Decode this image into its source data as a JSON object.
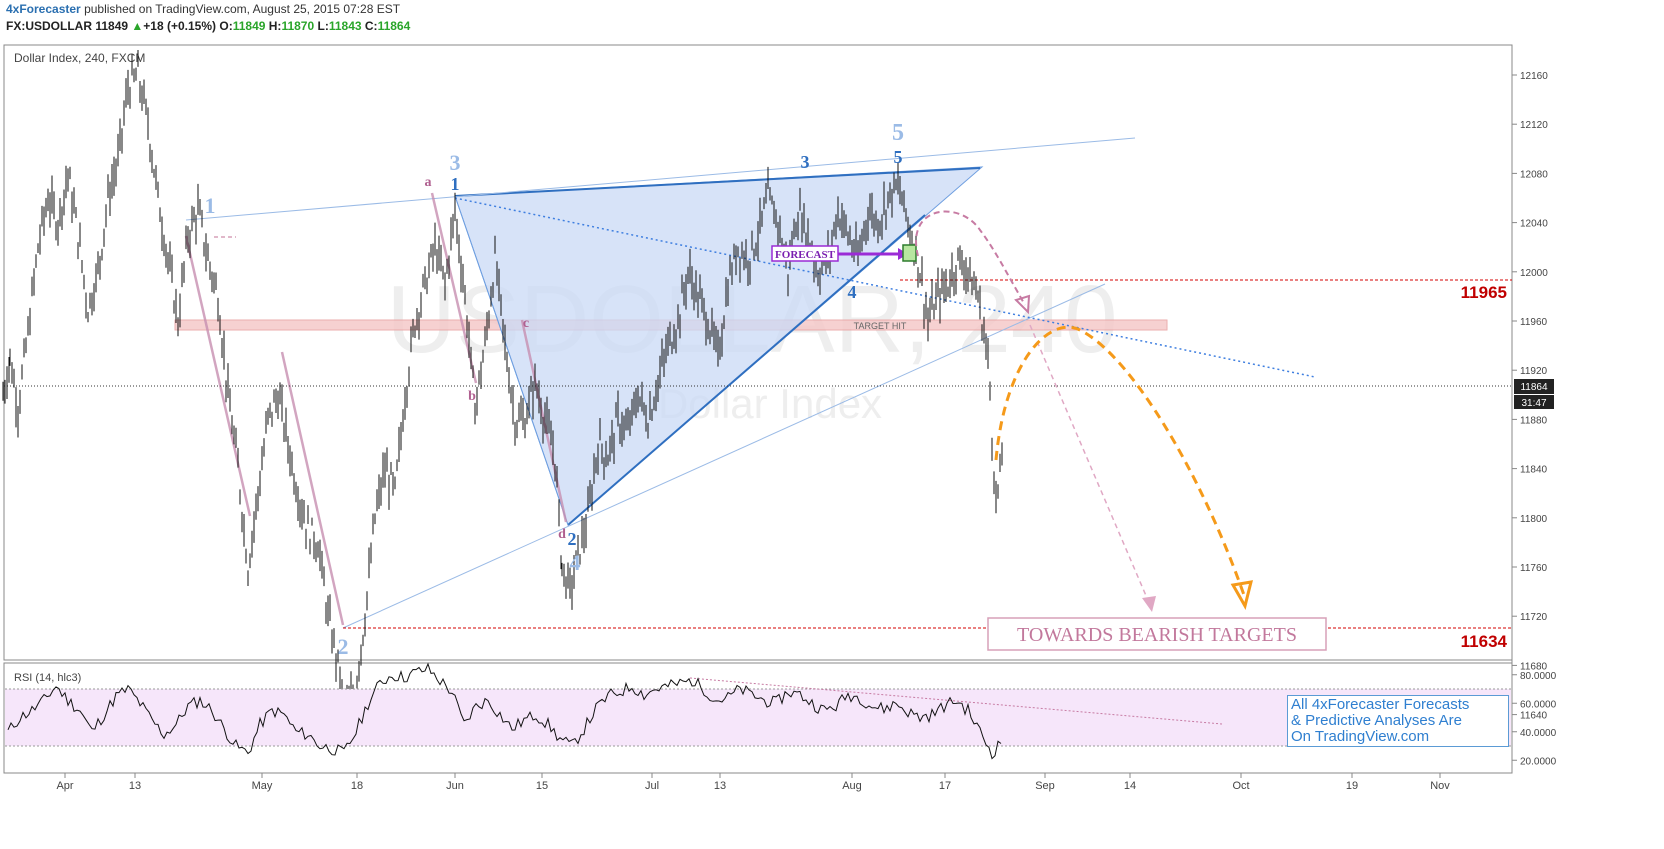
{
  "header": {
    "publisher": "4xForecaster",
    "published_text": "published on TradingView.com, August 25, 2015 07:28 EST",
    "symbol": "FX:USDOLLAR",
    "last": "11849",
    "change": "+18 (+0.15%)",
    "open_label": "O:",
    "open": "11849",
    "high_label": "H:",
    "high": "11870",
    "low_label": "L:",
    "low": "11843",
    "close_label": "C:",
    "close": "11864"
  },
  "chart_title": "Dollar Index, 240, FXCM",
  "watermark": {
    "line1": "USDOLLAR, 240",
    "line2": "Dollar Index"
  },
  "rsi_label": "RSI (14, hlc3)",
  "info_box": [
    "All 4xForecaster Forecasts",
    "& Predictive Analyses Are",
    "On TradingView.com"
  ],
  "annotations": {
    "forecast": "FORECAST",
    "target_hit": "TARGET HIT",
    "towards": "TOWARDS BEARISH TARGETS",
    "level_high": "11965",
    "level_low": "11634",
    "current_price": "11864",
    "countdown": "31:47"
  },
  "colors": {
    "accent": "#2a6fb0",
    "wave_light": "#9bbbe6",
    "wave_dark": "#2f6fc0",
    "abcd": "#c0759d",
    "level": "#d40000",
    "forecast_purple": "#9b2bd6",
    "orange": "#f59a1a",
    "triangle_fill": "#c9daf5",
    "rsi_band": "#f6e6fa"
  },
  "chart_data": {
    "type": "line",
    "x_ticks": [
      "Apr",
      "13",
      "May",
      "18",
      "Jun",
      "15",
      "Jul",
      "13",
      "Aug",
      "17",
      "Sep",
      "14",
      "Oct",
      "19",
      "Nov"
    ],
    "price_axis": [
      12160,
      12120,
      12080,
      12040,
      12000,
      11960,
      11920,
      11880,
      11840,
      11800,
      11760,
      11720,
      11680,
      11640
    ],
    "price_ylim": [
      11610,
      12195
    ],
    "rsi_axis": [
      80,
      60,
      40,
      20
    ],
    "rsi_band": [
      30,
      70
    ],
    "price_path": [
      [
        3,
        11900
      ],
      [
        10,
        11930
      ],
      [
        18,
        11890
      ],
      [
        28,
        11950
      ],
      [
        38,
        12020
      ],
      [
        48,
        12060
      ],
      [
        58,
        12040
      ],
      [
        68,
        12080
      ],
      [
        78,
        12030
      ],
      [
        88,
        11970
      ],
      [
        98,
        12000
      ],
      [
        108,
        12060
      ],
      [
        118,
        12090
      ],
      [
        128,
        12150
      ],
      [
        138,
        12160
      ],
      [
        148,
        12120
      ],
      [
        158,
        12060
      ],
      [
        168,
        12010
      ],
      [
        178,
        11960
      ],
      [
        188,
        12030
      ],
      [
        198,
        12050
      ],
      [
        208,
        12010
      ],
      [
        218,
        11980
      ],
      [
        228,
        11900
      ],
      [
        238,
        11840
      ],
      [
        248,
        11760
      ],
      [
        258,
        11820
      ],
      [
        268,
        11880
      ],
      [
        278,
        11900
      ],
      [
        288,
        11860
      ],
      [
        298,
        11820
      ],
      [
        308,
        11790
      ],
      [
        318,
        11780
      ],
      [
        328,
        11720
      ],
      [
        338,
        11680
      ],
      [
        345,
        11640
      ],
      [
        355,
        11660
      ],
      [
        365,
        11720
      ],
      [
        375,
        11800
      ],
      [
        385,
        11840
      ],
      [
        395,
        11820
      ],
      [
        405,
        11900
      ],
      [
        415,
        11960
      ],
      [
        425,
        11990
      ],
      [
        435,
        12020
      ],
      [
        445,
        11990
      ],
      [
        455,
        12050
      ],
      [
        465,
        11980
      ],
      [
        475,
        11890
      ],
      [
        485,
        11940
      ],
      [
        495,
        12010
      ],
      [
        505,
        11940
      ],
      [
        515,
        11880
      ],
      [
        525,
        11880
      ],
      [
        535,
        11910
      ],
      [
        545,
        11880
      ],
      [
        555,
        11850
      ],
      [
        562,
        11760
      ],
      [
        570,
        11740
      ],
      [
        578,
        11770
      ],
      [
        588,
        11800
      ],
      [
        598,
        11860
      ],
      [
        608,
        11850
      ],
      [
        618,
        11880
      ],
      [
        628,
        11870
      ],
      [
        638,
        11900
      ],
      [
        648,
        11880
      ],
      [
        658,
        11910
      ],
      [
        668,
        11940
      ],
      [
        678,
        11960
      ],
      [
        688,
        12000
      ],
      [
        698,
        11980
      ],
      [
        708,
        11960
      ],
      [
        718,
        11930
      ],
      [
        728,
        11990
      ],
      [
        738,
        12020
      ],
      [
        748,
        12010
      ],
      [
        758,
        12030
      ],
      [
        768,
        12060
      ],
      [
        778,
        12040
      ],
      [
        788,
        12000
      ],
      [
        798,
        12050
      ],
      [
        808,
        12030
      ],
      [
        818,
        12000
      ],
      [
        828,
        12010
      ],
      [
        838,
        12050
      ],
      [
        848,
        12030
      ],
      [
        858,
        12010
      ],
      [
        868,
        12050
      ],
      [
        878,
        12040
      ],
      [
        888,
        12060
      ],
      [
        898,
        12070
      ],
      [
        908,
        12040
      ],
      [
        918,
        12010
      ],
      [
        928,
        11960
      ],
      [
        938,
        11980
      ],
      [
        948,
        11990
      ],
      [
        958,
        12010
      ],
      [
        968,
        12000
      ],
      [
        978,
        11980
      ],
      [
        988,
        11930
      ],
      [
        996,
        11810
      ],
      [
        1004,
        11860
      ]
    ],
    "rsi_path": [
      [
        8,
        40
      ],
      [
        20,
        50
      ],
      [
        32,
        55
      ],
      [
        44,
        62
      ],
      [
        56,
        72
      ],
      [
        68,
        62
      ],
      [
        80,
        55
      ],
      [
        92,
        40
      ],
      [
        104,
        52
      ],
      [
        116,
        65
      ],
      [
        128,
        70
      ],
      [
        140,
        60
      ],
      [
        152,
        48
      ],
      [
        164,
        38
      ],
      [
        176,
        45
      ],
      [
        188,
        58
      ],
      [
        200,
        62
      ],
      [
        212,
        55
      ],
      [
        224,
        42
      ],
      [
        236,
        30
      ],
      [
        248,
        25
      ],
      [
        260,
        45
      ],
      [
        272,
        55
      ],
      [
        284,
        52
      ],
      [
        296,
        40
      ],
      [
        308,
        38
      ],
      [
        320,
        30
      ],
      [
        332,
        28
      ],
      [
        344,
        25
      ],
      [
        356,
        40
      ],
      [
        368,
        60
      ],
      [
        380,
        74
      ],
      [
        392,
        80
      ],
      [
        404,
        78
      ],
      [
        416,
        82
      ],
      [
        428,
        84
      ],
      [
        440,
        76
      ],
      [
        452,
        68
      ],
      [
        464,
        45
      ],
      [
        476,
        58
      ],
      [
        488,
        62
      ],
      [
        500,
        52
      ],
      [
        512,
        42
      ],
      [
        524,
        48
      ],
      [
        536,
        52
      ],
      [
        548,
        45
      ],
      [
        560,
        35
      ],
      [
        572,
        30
      ],
      [
        584,
        42
      ],
      [
        596,
        56
      ],
      [
        608,
        65
      ],
      [
        620,
        68
      ],
      [
        632,
        72
      ],
      [
        644,
        66
      ],
      [
        656,
        70
      ],
      [
        668,
        72
      ],
      [
        680,
        74
      ],
      [
        692,
        76
      ],
      [
        704,
        70
      ],
      [
        716,
        62
      ],
      [
        728,
        64
      ],
      [
        740,
        70
      ],
      [
        752,
        66
      ],
      [
        764,
        62
      ],
      [
        776,
        60
      ],
      [
        788,
        68
      ],
      [
        800,
        66
      ],
      [
        812,
        60
      ],
      [
        824,
        55
      ],
      [
        836,
        58
      ],
      [
        848,
        66
      ],
      [
        860,
        64
      ],
      [
        872,
        58
      ],
      [
        884,
        56
      ],
      [
        896,
        60
      ],
      [
        908,
        54
      ],
      [
        920,
        50
      ],
      [
        932,
        52
      ],
      [
        944,
        58
      ],
      [
        956,
        62
      ],
      [
        968,
        55
      ],
      [
        980,
        40
      ],
      [
        992,
        25
      ],
      [
        1004,
        35
      ]
    ]
  }
}
